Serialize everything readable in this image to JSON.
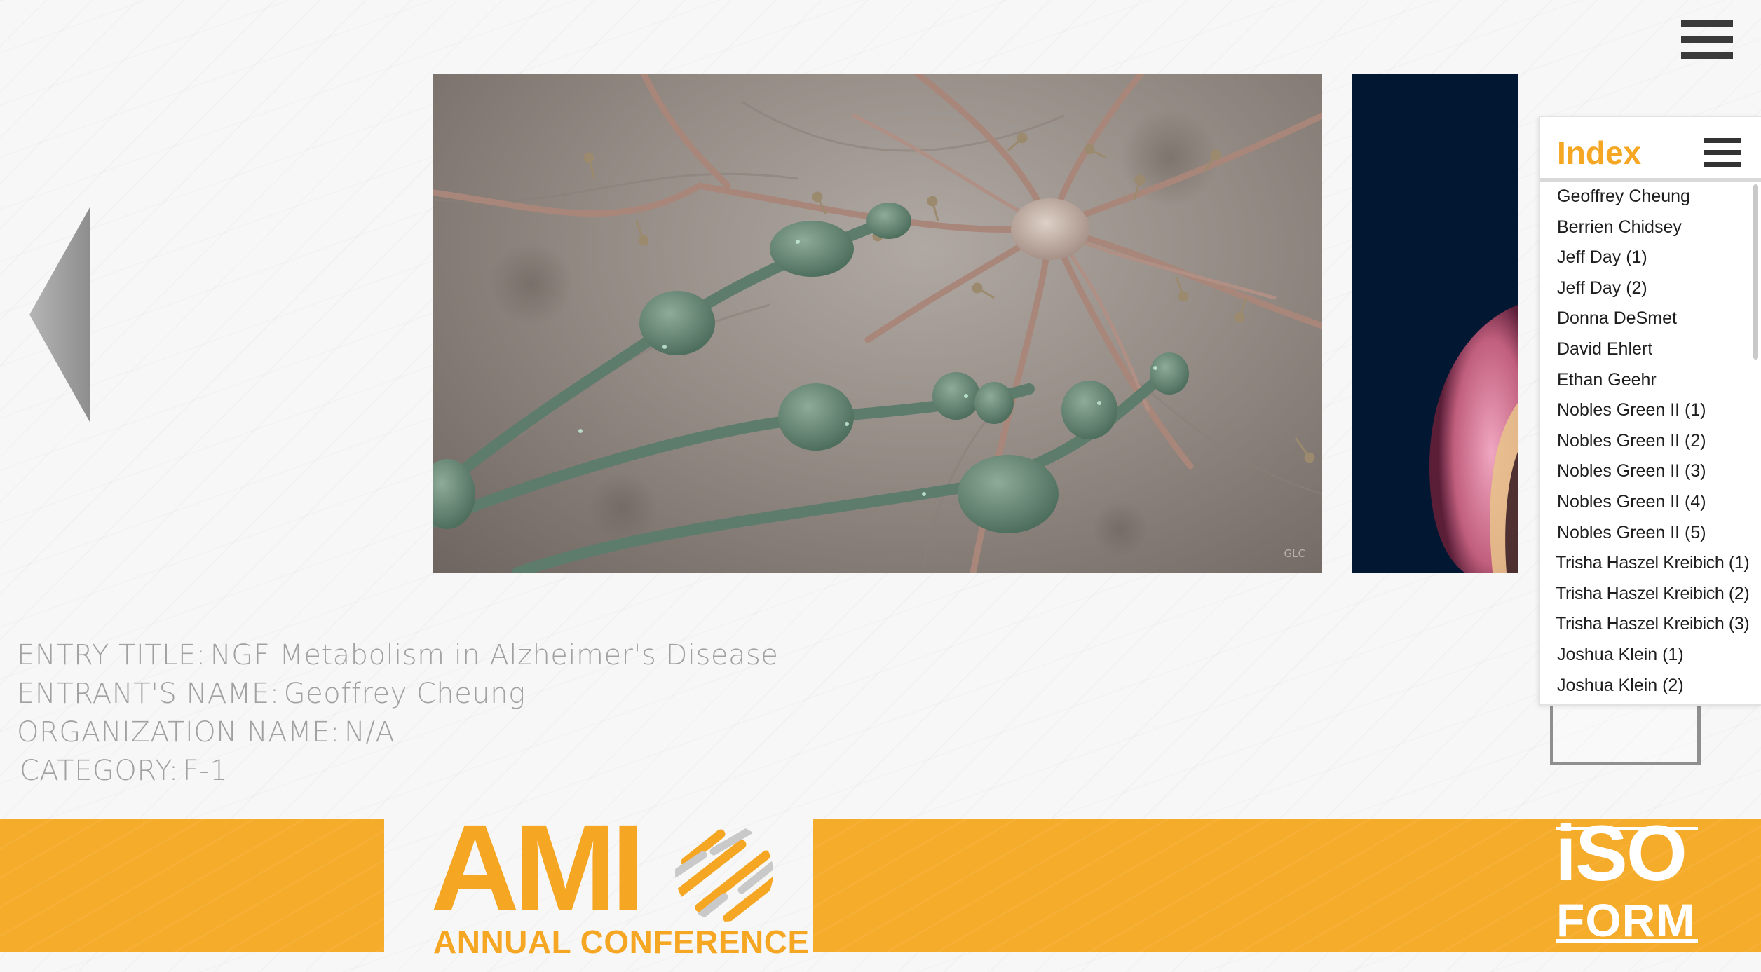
{
  "top_menu": {
    "icon": "hamburger-icon"
  },
  "navigation": {
    "prev_icon": "triangle-left-icon",
    "next_icon": "triangle-right-icon"
  },
  "main_image": {
    "watermark": "GLC"
  },
  "entry": {
    "title_label": "ENTRY TITLE:",
    "title_value": "NGF Metabolism in Alzheimer's Disease",
    "entrant_label": "ENTRANT'S NAME:",
    "entrant_value": "Geoffrey Cheung",
    "org_label": "ORGANIZATION NAME:",
    "org_value": "N/A",
    "category_label": "CATEGORY:",
    "category_value": "F-1"
  },
  "index": {
    "title": "Index",
    "menu_icon": "hamburger-icon",
    "items": [
      "Geoffrey Cheung",
      "Berrien Chidsey",
      "Jeff Day (1)",
      "Jeff Day (2)",
      "Donna DeSmet",
      "David Ehlert",
      "Ethan Geehr",
      "Nobles Green II (1)",
      "Nobles Green II (2)",
      "Nobles Green II (3)",
      "Nobles Green II (4)",
      "Nobles Green II (5)",
      "Trisha Haszel Kreibich (1)",
      "Trisha Haszel Kreibich (2)",
      "Trisha Haszel Kreibich (3)",
      "Joshua Klein (1)",
      "Joshua Klein (2)"
    ]
  },
  "footer": {
    "ami_text": "AMI",
    "ami_subtitle": "ANNUAL CONFERENCE",
    "iso_top": "iSO",
    "iso_bottom": "FORM"
  },
  "colors": {
    "accent_orange": "#f5a623",
    "band_orange": "#f5ac2b",
    "text_gray": "#a1a1a1",
    "dark_navy": "#021731"
  }
}
